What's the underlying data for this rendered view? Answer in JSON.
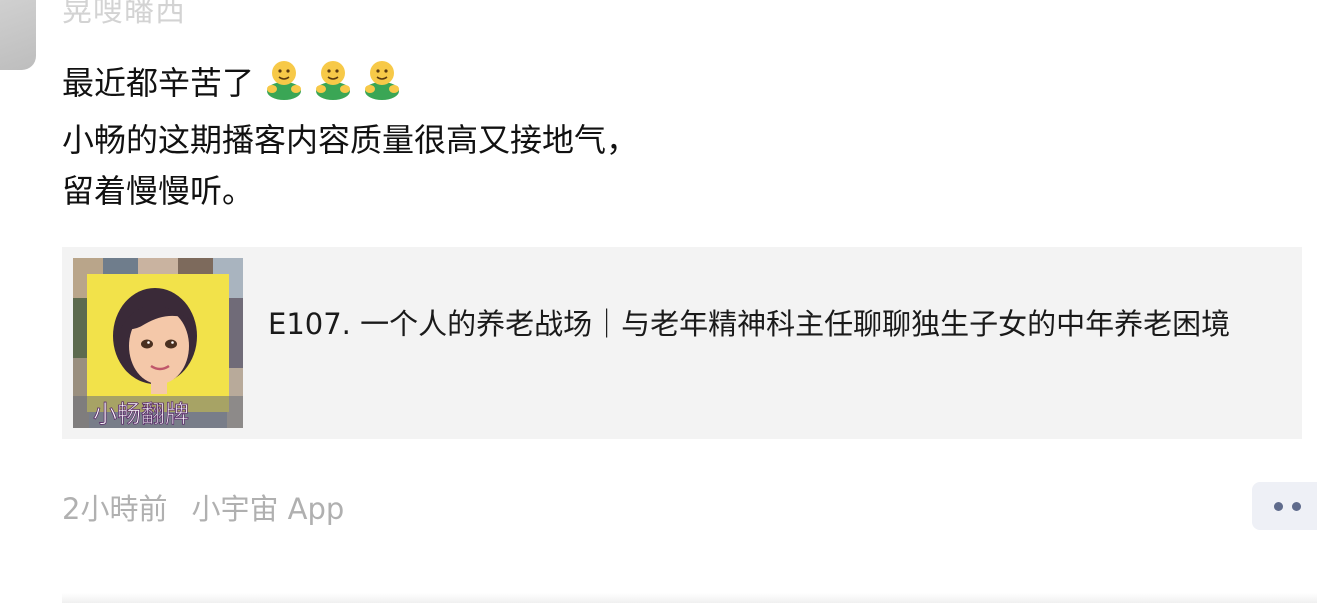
{
  "post": {
    "author_name": "晃嗖皤西",
    "text_lines": [
      "最近都辛苦了",
      "小畅的这期播客内容质量很高又接地气，",
      "留着慢慢听。"
    ],
    "emojis": [
      "hug-emoji",
      "hug-emoji",
      "hug-emoji"
    ]
  },
  "share_card": {
    "cover_label": "小畅翻牌",
    "title": "E107. 一个人的养老战场｜与老年精神科主任聊聊独生子女的中年养老困境"
  },
  "meta": {
    "time": "2小時前",
    "source": "小宇宙 App"
  },
  "colors": {
    "card_bg": "#f3f3f3",
    "meta_text": "#b0b0b0",
    "more_dot": "#5f6b8c",
    "cover_yellow": "#f2e24a"
  }
}
